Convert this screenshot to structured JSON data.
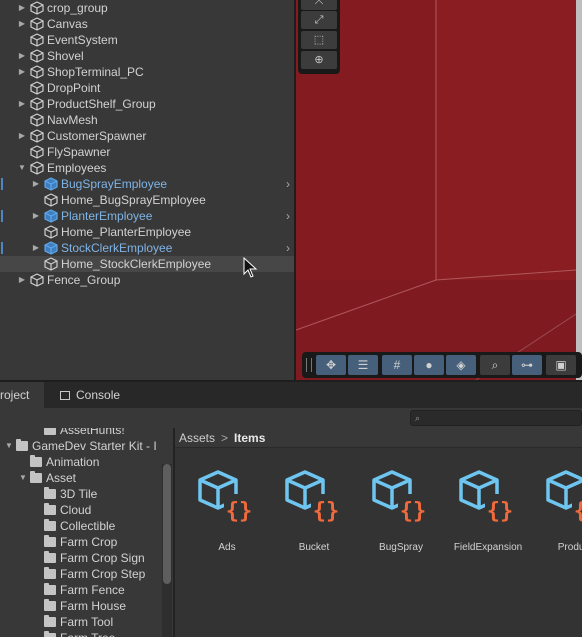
{
  "hierarchy": {
    "items": [
      {
        "label": "crop_group",
        "foldable": true,
        "expanded": false,
        "prefab": false
      },
      {
        "label": "Canvas",
        "foldable": true,
        "expanded": false,
        "prefab": false
      },
      {
        "label": "EventSystem",
        "foldable": false,
        "expanded": false,
        "prefab": false
      },
      {
        "label": "Shovel",
        "foldable": true,
        "expanded": false,
        "prefab": false
      },
      {
        "label": "ShopTerminal_PC",
        "foldable": true,
        "expanded": false,
        "prefab": false
      },
      {
        "label": "DropPoint",
        "foldable": false,
        "expanded": false,
        "prefab": false
      },
      {
        "label": "ProductShelf_Group",
        "foldable": true,
        "expanded": false,
        "prefab": false
      },
      {
        "label": "NavMesh",
        "foldable": false,
        "expanded": false,
        "prefab": false
      },
      {
        "label": "CustomerSpawner",
        "foldable": true,
        "expanded": false,
        "prefab": false
      },
      {
        "label": "FlySpawner",
        "foldable": false,
        "expanded": false,
        "prefab": false
      },
      {
        "label": "Employees",
        "foldable": true,
        "expanded": true,
        "prefab": false
      },
      {
        "label": "BugSprayEmployee",
        "foldable": true,
        "expanded": false,
        "prefab": true
      },
      {
        "label": "Home_BugSprayEmployee",
        "foldable": false,
        "expanded": false,
        "prefab": false
      },
      {
        "label": "PlanterEmployee",
        "foldable": true,
        "expanded": false,
        "prefab": true
      },
      {
        "label": "Home_PlanterEmployee",
        "foldable": false,
        "expanded": false,
        "prefab": false
      },
      {
        "label": "StockClerkEmployee",
        "foldable": true,
        "expanded": false,
        "prefab": true
      },
      {
        "label": "Home_StockClerkEmployee",
        "foldable": false,
        "expanded": false,
        "prefab": false
      },
      {
        "label": "Fence_Group",
        "foldable": true,
        "expanded": false,
        "prefab": false
      }
    ]
  },
  "scene": {
    "vertical_tools": [
      "move-tool-icon",
      "scale-tool-icon",
      "rect-tool-icon",
      "transform-tool-icon"
    ],
    "bottom_tools": [
      "move-snap-icon",
      "align-icon",
      "grid-snap-icon",
      "shading-sphere-icon",
      "layers-icon",
      "search-icon",
      "pivot-icon",
      "camera-icon"
    ],
    "colors": {
      "wall": "#8a1d22",
      "toolbar_active": "#46607c"
    }
  },
  "project": {
    "tabs": [
      {
        "label": "Project",
        "active": true
      },
      {
        "label": "Console",
        "active": false
      }
    ],
    "tree": [
      {
        "label": "AssetHunts!",
        "foldable": false,
        "expanded": false
      },
      {
        "label": "GameDev Starter Kit - I",
        "foldable": true,
        "expanded": true
      },
      {
        "label": "Animation",
        "foldable": false,
        "expanded": false
      },
      {
        "label": "Asset",
        "foldable": true,
        "expanded": true
      },
      {
        "label": "3D Tile",
        "foldable": false,
        "expanded": false
      },
      {
        "label": "Cloud",
        "foldable": false,
        "expanded": false
      },
      {
        "label": "Collectible",
        "foldable": false,
        "expanded": false
      },
      {
        "label": "Farm Crop",
        "foldable": false,
        "expanded": false
      },
      {
        "label": "Farm Crop Sign",
        "foldable": false,
        "expanded": false
      },
      {
        "label": "Farm Crop Step",
        "foldable": false,
        "expanded": false
      },
      {
        "label": "Farm Fence",
        "foldable": false,
        "expanded": false
      },
      {
        "label": "Farm House",
        "foldable": false,
        "expanded": false
      },
      {
        "label": "Farm Tool",
        "foldable": false,
        "expanded": false
      },
      {
        "label": "Farm Tree",
        "foldable": false,
        "expanded": false
      }
    ],
    "breadcrumb": {
      "root": "Assets",
      "separator": ">",
      "current": "Items"
    },
    "assets": [
      {
        "name": "Ads"
      },
      {
        "name": "Bucket"
      },
      {
        "name": "BugSpray"
      },
      {
        "name": "FieldExpansion"
      },
      {
        "name": "Product"
      }
    ],
    "colors": {
      "asset_cube": "#6ec6f0",
      "asset_braces": "#f06a3c"
    }
  }
}
